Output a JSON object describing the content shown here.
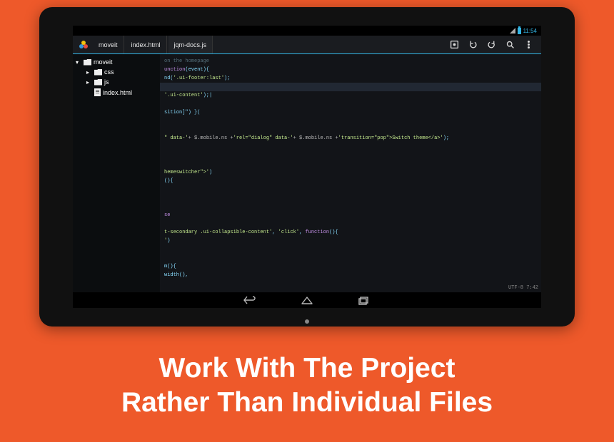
{
  "status": {
    "time": "11:54"
  },
  "tabs": [
    "moveit",
    "index.html",
    "jqm-docs.js"
  ],
  "active_tab": 2,
  "tree": {
    "root": {
      "name": "moveit",
      "expanded": true
    },
    "children": [
      {
        "name": "css",
        "type": "folder"
      },
      {
        "name": "js",
        "type": "folder"
      },
      {
        "name": "index.html",
        "type": "file"
      }
    ]
  },
  "code": {
    "lines": [
      {
        "raw": "on the homepage",
        "cls": "com"
      },
      {
        "raw": "unction(event){",
        "frag": [
          {
            "t": "unction",
            "c": "kw"
          },
          {
            "t": "(event){",
            "c": "punc"
          }
        ]
      },
      {
        "raw": "nd('.ui-footer:last');",
        "frag": [
          {
            "t": "nd(",
            "c": "punc"
          },
          {
            "t": "'.ui-footer:last'",
            "c": "str"
          },
          {
            "t": ");",
            "c": "punc"
          }
        ]
      },
      {
        "raw": ""
      },
      {
        "raw": "'.ui-content');|",
        "frag": [
          {
            "t": "'.ui-content'",
            "c": "str"
          },
          {
            "t": ");|",
            "c": "punc"
          }
        ]
      },
      {
        "raw": ""
      },
      {
        "raw": "sition]\") }(",
        "frag": [
          {
            "t": "sition]\") }(",
            "c": "punc"
          }
        ]
      },
      {
        "raw": ""
      },
      {
        "raw": ""
      },
      {
        "raw": "\" data-'+ $.mobile.ns +'rel=\"dialog\" data-'+ $.mobile.ns +'transition=\"pop\">Switch theme</a>');",
        "frag": [
          {
            "t": "\" data-'",
            "c": "str"
          },
          {
            "t": "+ $.mobile.ns +",
            "c": ""
          },
          {
            "t": "'rel=\"dialog\" data-'",
            "c": "str"
          },
          {
            "t": "+ $.mobile.ns +",
            "c": ""
          },
          {
            "t": "'transition=\"pop\">Switch theme</a>'",
            "c": "str"
          },
          {
            "t": ");",
            "c": "punc"
          }
        ]
      },
      {
        "raw": ""
      },
      {
        "raw": ""
      },
      {
        "raw": ""
      },
      {
        "raw": "hemeswitcher\">')",
        "frag": [
          {
            "t": "hemeswitcher\">'",
            "c": "str"
          },
          {
            "t": ")",
            "c": "punc"
          }
        ]
      },
      {
        "raw": "(){",
        "frag": [
          {
            "t": "(){",
            "c": "punc"
          }
        ]
      },
      {
        "raw": ""
      },
      {
        "raw": ""
      },
      {
        "raw": ""
      },
      {
        "raw": "se",
        "frag": [
          {
            "t": "se",
            "c": "kw"
          }
        ]
      },
      {
        "raw": ""
      },
      {
        "raw": "t-secondary .ui-collapsible-content', 'click', function(){",
        "frag": [
          {
            "t": "t-secondary .ui-collapsible-content'",
            "c": "str"
          },
          {
            "t": ", ",
            "c": "punc"
          },
          {
            "t": "'click'",
            "c": "str"
          },
          {
            "t": ", ",
            "c": "punc"
          },
          {
            "t": "function",
            "c": "kw"
          },
          {
            "t": "(){",
            "c": "punc"
          }
        ]
      },
      {
        "raw": "')",
        "frag": [
          {
            "t": "'",
            "c": "str"
          },
          {
            "t": ")",
            "c": "punc"
          }
        ]
      },
      {
        "raw": ""
      },
      {
        "raw": ""
      },
      {
        "raw": "m(){",
        "frag": [
          {
            "t": "m(){",
            "c": "punc"
          }
        ]
      },
      {
        "raw": "width(),",
        "frag": [
          {
            "t": "width(),",
            "c": "punc"
          }
        ]
      }
    ],
    "status": "UTF-8 7:42"
  },
  "caption": {
    "line1": "Work With The Project",
    "line2": "Rather Than Individual Files"
  }
}
